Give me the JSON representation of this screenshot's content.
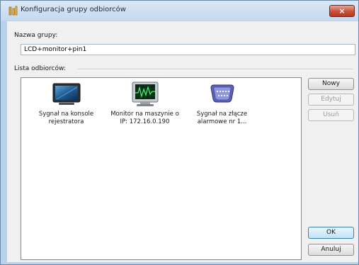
{
  "window": {
    "title": "Konfiguracja grupy odbiorców",
    "close_symbol": "×"
  },
  "form": {
    "group_name_label": "Nazwa grupy:",
    "group_name_value": "LCD+monitor+pin1",
    "list_label": "Lista odbiorców:"
  },
  "recipients": [
    {
      "icon": "lcd-display-icon",
      "line1": "Sygnał na konsole",
      "line2": "rejestratora"
    },
    {
      "icon": "monitor-waveform-icon",
      "line1": "Monitor na maszynie o",
      "line2": "IP: 172.16.0.190"
    },
    {
      "icon": "serial-connector-icon",
      "line1": "Sygnał na złącze",
      "line2": "alarmowe nr 1..."
    }
  ],
  "buttons": {
    "new": "Nowy",
    "edit": "Edytuj",
    "delete": "Usuń",
    "ok": "OK",
    "cancel": "Anuluj"
  },
  "colors": {
    "frame": "#b9d1ea",
    "close_button": "#c7503a",
    "disabled_text": "#9a9a9a"
  }
}
